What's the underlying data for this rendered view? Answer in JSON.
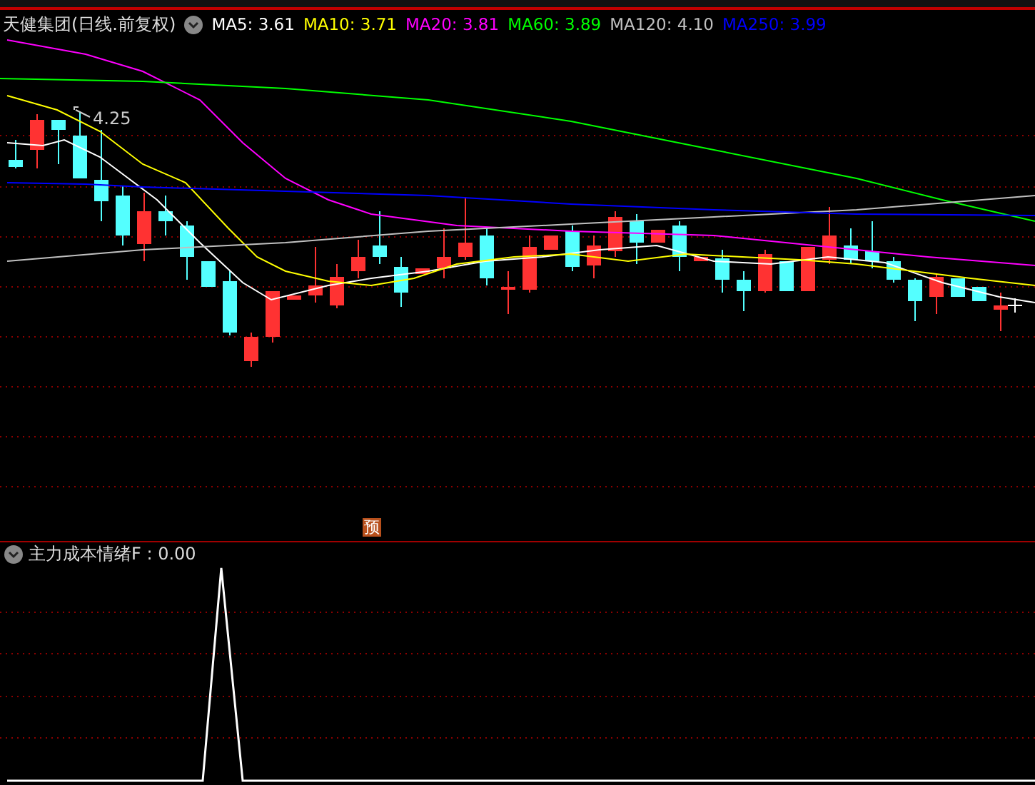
{
  "chart_header": {
    "title": "天健集团(日线.前复权)",
    "moving_averages": [
      {
        "label": "MA5: 3.61",
        "color": "#ffffff"
      },
      {
        "label": "MA10: 3.71",
        "color": "#ffff00"
      },
      {
        "label": "MA20: 3.81",
        "color": "#ff00ff"
      },
      {
        "label": "MA60: 3.89",
        "color": "#00ff00"
      },
      {
        "label": "MA120: 4.10",
        "color": "#c0c0c0"
      },
      {
        "label": "MA250: 3.99",
        "color": "#0000ff"
      }
    ]
  },
  "price_chart": {
    "high_marker": "4.25",
    "forecast_badge": "预"
  },
  "indicator_panel": {
    "label": "主力成本情绪F : 0.00"
  }
}
